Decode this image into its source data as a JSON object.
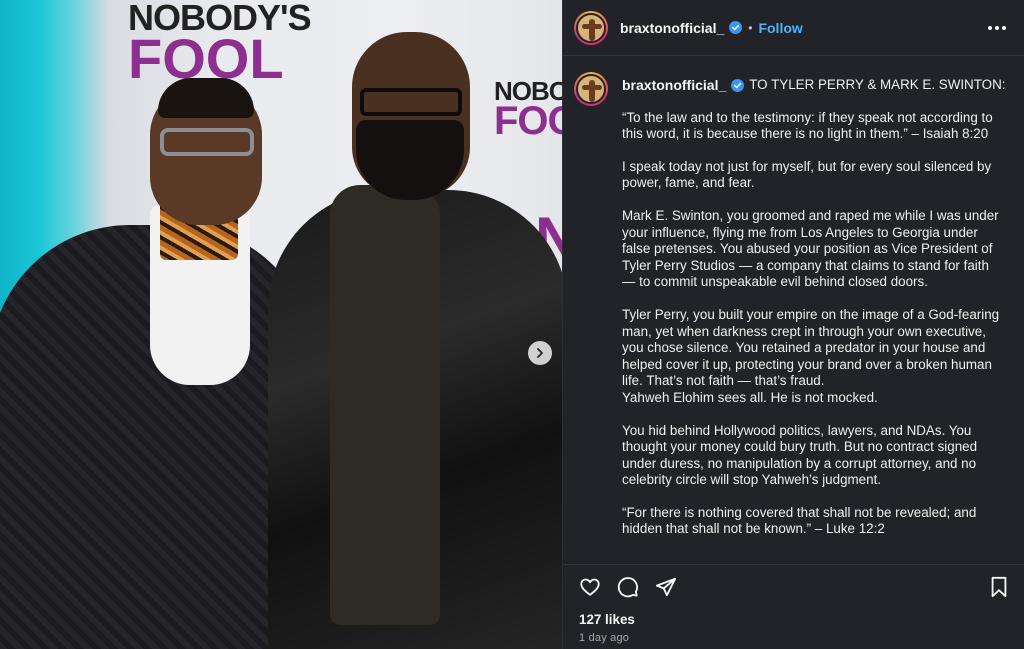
{
  "photo": {
    "backdrop_line1": "NOBODY'S",
    "backdrop_line2": "FOOL",
    "backdrop_repeat1": "NOBOD",
    "backdrop_repeat2": "FOO",
    "backdrop_repeat3": "NO"
  },
  "header": {
    "username": "braxtonofficial_",
    "separator": "•",
    "follow_label": "Follow"
  },
  "caption": {
    "username": "braxtonofficial_",
    "lead": "TO TYLER PERRY & MARK E. SWINTON:",
    "para1": "“To the law and to the testimony: if they speak not according to this word, it is because there is no light in them.” – Isaiah 8:20",
    "para2": "I speak today not just for myself, but for every soul silenced by power, fame, and fear.",
    "para3": "Mark E. Swinton, you groomed and raped me while I was under your influence, flying me from Los Angeles to Georgia under false pretenses. You abused your position as Vice President of Tyler Perry Studios — a company that claims to stand for faith — to commit unspeakable evil behind closed doors.",
    "para4": "Tyler Perry, you built your empire on the image of a God-fearing man, yet when darkness crept in through your own executive, you chose silence. You retained a predator in your house and helped cover it up, protecting your brand over a broken human life. That’s not faith — that’s fraud.",
    "para4b": "Yahweh Elohim sees all. He is not mocked.",
    "para5": "You hid behind Hollywood politics, lawyers, and NDAs. You thought your money could bury truth. But no contract signed under duress, no manipulation by a corrupt attorney, and no celebrity circle will stop Yahweh’s judgment.",
    "para6": "“For there is nothing covered that shall not be revealed; and hidden that shall not be known.” – Luke 12:2"
  },
  "footer": {
    "likes": "127 likes",
    "time": "1 day ago"
  },
  "colors": {
    "follow": "#4cb5f9",
    "panel_bg": "#212328",
    "verified": "#3897f0"
  },
  "icons": [
    "heart-icon",
    "comment-icon",
    "share-icon",
    "bookmark-icon",
    "chevron-right-icon",
    "more-icon",
    "verified-badge-icon"
  ]
}
